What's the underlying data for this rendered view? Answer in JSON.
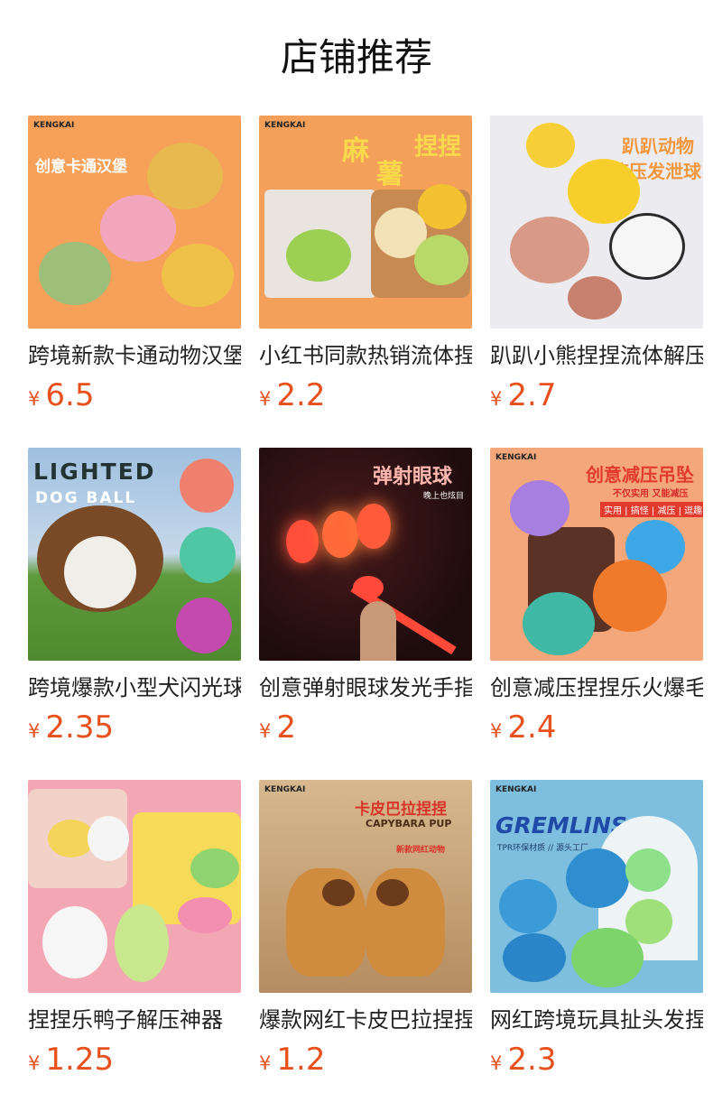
{
  "page": {
    "title": "店铺推荐"
  },
  "currency_symbol": "¥",
  "products": [
    {
      "name": "跨境新款卡通动物汉堡",
      "price": "6.5",
      "image_text": [
        "创意卡通汉堡"
      ],
      "bg": "#f7a05a"
    },
    {
      "name": "小红书同款热销流体捏捏",
      "price": "2.2",
      "image_text": [
        "麻",
        "薯",
        "捏捏"
      ],
      "bg": "#f4a05b"
    },
    {
      "name": "趴趴小熊捏捏流体解压",
      "price": "2.7",
      "image_text": [
        "趴趴动物",
        "挤压发泄球"
      ],
      "bg": "#ececf0"
    },
    {
      "name": "跨境爆款小型犬闪光球",
      "price": "2.35",
      "image_text": [
        "LIGHTED",
        "DOG BALL"
      ],
      "bg": "#8fb4d8"
    },
    {
      "name": "创意弹射眼球发光手指",
      "price": "2",
      "image_text": [
        "弹射眼球",
        "晚上也炫目"
      ],
      "bg": "#2a1012"
    },
    {
      "name": "创意减压捏捏乐火爆毛毛球",
      "price": "2.4",
      "image_text": [
        "创意减压吊坠",
        "不仅实用 又能减压",
        "实用 | 搞怪 | 减压 | 逗趣"
      ],
      "bg": "#f4a77a"
    },
    {
      "name": "捏捏乐鸭子解压神器",
      "price": "1.25",
      "image_text": [],
      "bg": "#f3a7b4"
    },
    {
      "name": "爆款网红卡皮巴拉捏捏",
      "price": "1.2",
      "image_text": [
        "卡皮巴拉捏捏",
        "CAPYBARA PUP",
        "新款网红动物"
      ],
      "bg": "#c7a57a"
    },
    {
      "name": "网红跨境玩具扯头发捏捏",
      "price": "2.3",
      "image_text": [
        "GREMLINS",
        "TPR环保材质 // 源头工厂"
      ],
      "bg": "#7ebfe0"
    }
  ],
  "brand_label": "KENGKAI"
}
